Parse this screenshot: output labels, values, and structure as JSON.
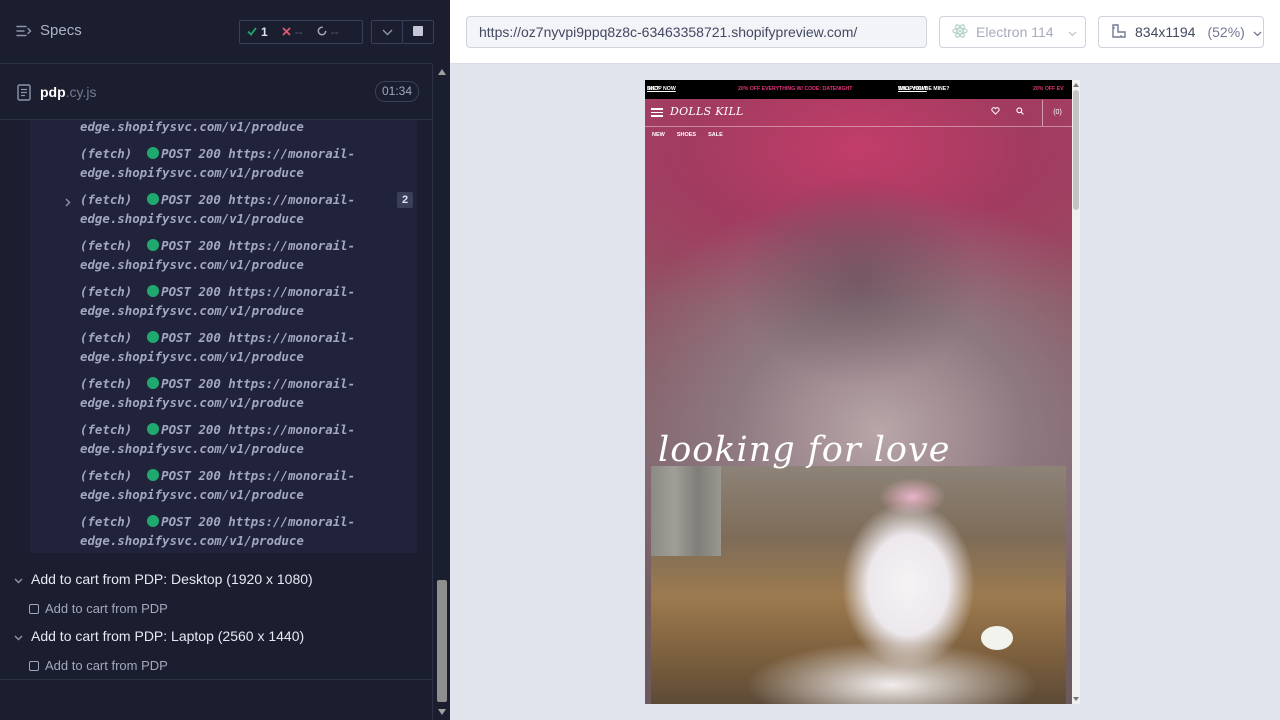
{
  "sidebar": {
    "specs_label": "Specs",
    "stats": {
      "passed": "1",
      "failed": "--",
      "pending": "--"
    },
    "spec_file": {
      "name": "pdp",
      "ext": ".cy.js",
      "duration": "01:34"
    },
    "log_first_line_tail": "edge.shopifysvc.com/v1/produce",
    "commands": [
      {
        "type": "(fetch)",
        "line1": "POST 200 https://monorail-",
        "line2": "edge.shopifysvc.com/v1/produce"
      },
      {
        "type": "(fetch)",
        "line1": "POST 200 https://monorail-",
        "line2": "edge.shopifysvc.com/v1/produce",
        "count": "2"
      },
      {
        "type": "(fetch)",
        "line1": "POST 200 https://monorail-",
        "line2": "edge.shopifysvc.com/v1/produce"
      },
      {
        "type": "(fetch)",
        "line1": "POST 200 https://monorail-",
        "line2": "edge.shopifysvc.com/v1/produce"
      },
      {
        "type": "(fetch)",
        "line1": "POST 200 https://monorail-",
        "line2": "edge.shopifysvc.com/v1/produce"
      },
      {
        "type": "(fetch)",
        "line1": "POST 200 https://monorail-",
        "line2": "edge.shopifysvc.com/v1/produce"
      },
      {
        "type": "(fetch)",
        "line1": "POST 200 https://monorail-",
        "line2": "edge.shopifysvc.com/v1/produce"
      },
      {
        "type": "(fetch)",
        "line1": "POST 200 https://monorail-",
        "line2": "edge.shopifysvc.com/v1/produce"
      },
      {
        "type": "(fetch)",
        "line1": "POST 200 https://monorail-",
        "line2": "edge.shopifysvc.com/v1/produce"
      }
    ],
    "groups": [
      {
        "title": "Add to cart from PDP: Desktop (1920 x 1080)",
        "test": "Add to cart from PDP"
      },
      {
        "title": "Add to cart from PDP: Laptop (2560 x 1440)",
        "test": "Add to cart from PDP"
      }
    ]
  },
  "toolbar": {
    "url": "https://oz7nyvpi9ppq8z8c-63463358721.shopifypreview.com/",
    "browser": "Electron 114",
    "viewport": "834x1194",
    "scale": "(52%)"
  },
  "aut": {
    "promo": [
      {
        "text": "INE? ",
        "link": "SHOP NOW",
        "color": "white"
      },
      {
        "text": "20% OFF EVERYTHING W/ CODE: DATENIGHT",
        "color": "pink"
      },
      {
        "text": "WILL YOU BE MINE? ",
        "link": "SHOP NOW",
        "color": "white"
      },
      {
        "text": "20% OFF EV",
        "color": "pink"
      }
    ],
    "logo": "DOLLS KILL",
    "categories": [
      "NEW",
      "SHOES",
      "SALE"
    ],
    "cart_label": "(0)",
    "headline": "looking for love"
  },
  "colors": {
    "pass_green": "#1fa971",
    "fail_red": "#e45770",
    "promo_pink": "#e0357a"
  }
}
